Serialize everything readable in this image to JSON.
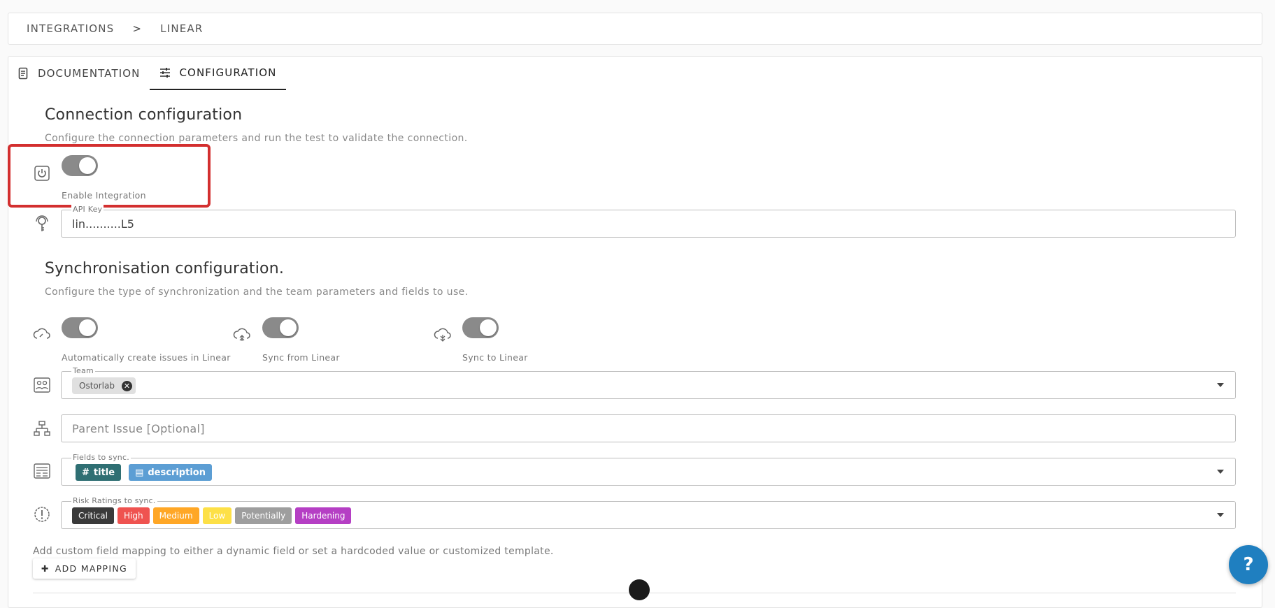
{
  "breadcrumb": {
    "root": "INTEGRATIONS",
    "separator": ">",
    "current": "LINEAR"
  },
  "tabs": [
    {
      "label": "DOCUMENTATION",
      "icon": "document-icon"
    },
    {
      "label": "CONFIGURATION",
      "icon": "sliders-icon"
    }
  ],
  "connection": {
    "title": "Connection configuration",
    "subtitle": "Configure the connection parameters and run the test to validate the connection.",
    "enable_label": "Enable Integration",
    "enable_on": true,
    "api_key_legend": "API Key",
    "api_key_value": "lin..........L5"
  },
  "sync": {
    "title": "Synchronisation configuration.",
    "subtitle": "Configure the type of synchronization and the team parameters and fields to use.",
    "toggles": [
      {
        "label": "Automatically create issues in Linear",
        "on": true
      },
      {
        "label": "Sync from Linear",
        "on": true
      },
      {
        "label": "Sync to Linear",
        "on": true
      }
    ],
    "team_legend": "Team",
    "team_chip": "Ostorlab",
    "parent_issue_placeholder": "Parent Issue [Optional]",
    "fields_legend": "Fields to sync.",
    "fields": [
      {
        "label": "title",
        "icon": "#"
      },
      {
        "label": "description",
        "icon": "▤"
      }
    ],
    "risk_legend": "Risk Ratings to sync.",
    "risks": [
      {
        "label": "Critical",
        "color": "#3a3a3a"
      },
      {
        "label": "High",
        "color": "#ef5350"
      },
      {
        "label": "Medium",
        "color": "#ffa726"
      },
      {
        "label": "Low",
        "color": "#fde047"
      },
      {
        "label": "Potentially",
        "color": "#9e9e9e"
      },
      {
        "label": "Hardening",
        "color": "#b53fc4"
      }
    ]
  },
  "mapping": {
    "description": "Add custom field mapping to either a dynamic field or set a hardcoded value or customized template.",
    "button_label": "ADD MAPPING"
  },
  "help_label": "?",
  "colors": {
    "highlight": "#d32f2f",
    "toggle": "#8a8a8a",
    "help": "#1f7fc0"
  }
}
